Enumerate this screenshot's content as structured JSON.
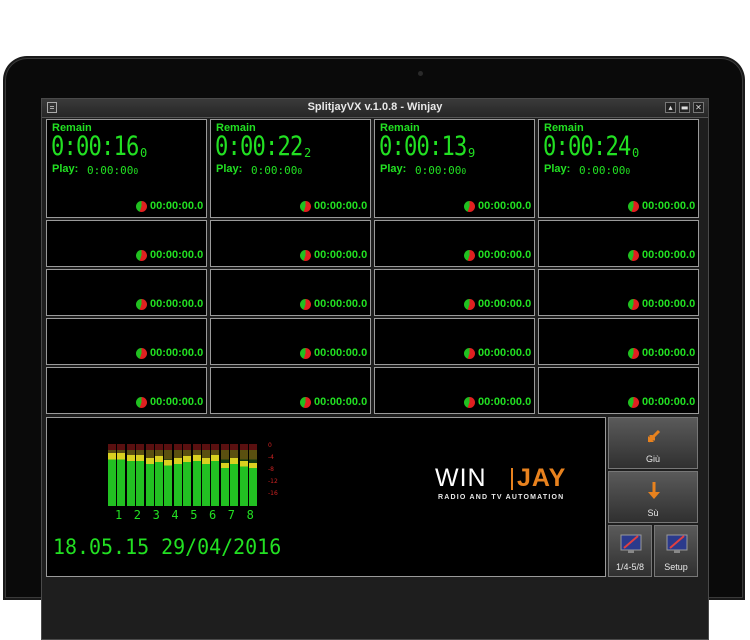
{
  "window": {
    "title": "SplitjayVX v.1.0.8 - Winjay",
    "minimize_glyph": "▴",
    "restore_glyph": "▬",
    "close_glyph": "✕"
  },
  "players": [
    {
      "remain_label": "Remain",
      "remain_time": "0:00:16",
      "remain_frac": "0",
      "play_label": "Play:",
      "play_time": "0:00:00",
      "play_frac": "0"
    },
    {
      "remain_label": "Remain",
      "remain_time": "0:00:22",
      "remain_frac": "2",
      "play_label": "Play:",
      "play_time": "0:00:00",
      "play_frac": "0"
    },
    {
      "remain_label": "Remain",
      "remain_time": "0:00:13",
      "remain_frac": "9",
      "play_label": "Play:",
      "play_time": "0:00:00",
      "play_frac": "0"
    },
    {
      "remain_label": "Remain",
      "remain_time": "0:00:24",
      "remain_frac": "0",
      "play_label": "Play:",
      "play_time": "0:00:00",
      "play_frac": "0"
    }
  ],
  "cue_time": "00:00:00.0",
  "vu_meter": {
    "scale": [
      "0",
      "-4",
      "-8",
      "-12",
      "-16"
    ],
    "channels": [
      "1",
      "2",
      "3",
      "4",
      "5",
      "6",
      "7",
      "8"
    ],
    "levels": [
      0.85,
      0.85,
      0.82,
      0.82,
      0.78,
      0.8,
      0.75,
      0.78,
      0.8,
      0.82,
      0.78,
      0.82,
      0.7,
      0.78,
      0.72,
      0.7
    ],
    "colors": {
      "green": "#22c022",
      "yellow": "#d8d020",
      "red": "#c02020"
    }
  },
  "date_time": "18.05.15 29/04/2016",
  "logo": {
    "win": "WIN",
    "jay": "JAY",
    "tagline": "RADIO AND TV AUTOMATION",
    "accent": "#e8821e"
  },
  "buttons": {
    "down_label": "Giù",
    "up_label": "Sù",
    "pages_label": "1/4-5/8",
    "setup_label": "Setup"
  },
  "colors": {
    "display_green": "#22e022",
    "window_bg": "#1e1e1e"
  }
}
